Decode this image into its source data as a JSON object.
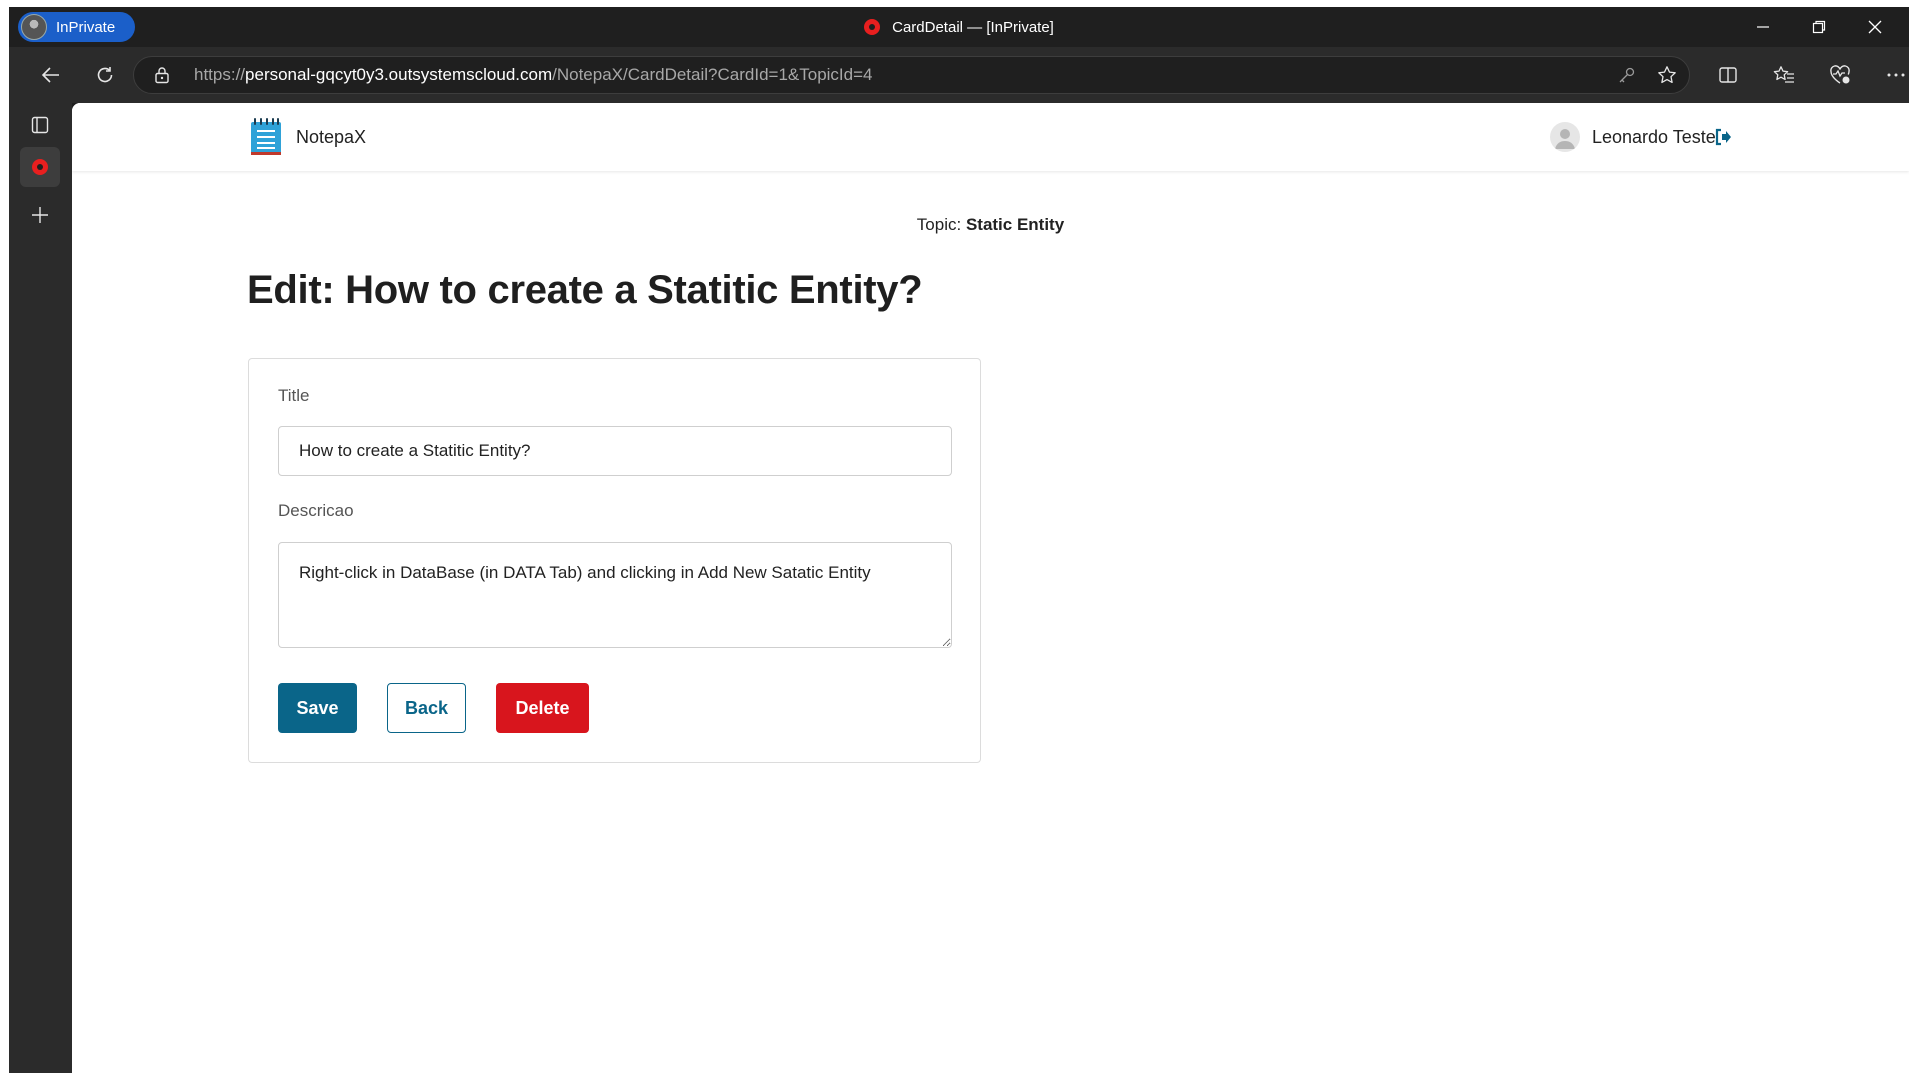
{
  "browser": {
    "inprivate_label": "InPrivate",
    "window_title": "CardDetail — [InPrivate]",
    "url_prefix": "https://",
    "url_host": "personal-gqcyt0y3.outsystemscloud.com",
    "url_path": "/NotepaX/CardDetail?CardId=1&TopicId=4"
  },
  "app": {
    "name": "NotepaX",
    "user_name": "Leonardo Teste"
  },
  "page": {
    "topic_label": "Topic: ",
    "topic_value": "Static Entity",
    "title": "Edit: How to create a Statitic Entity?"
  },
  "form": {
    "title_label": "Title",
    "title_value": "How to create a Statitic Entity?",
    "description_label": "Descricao",
    "description_value": "Right-click in DataBase (in DATA Tab) and clicking in Add New Satatic Entity",
    "save_label": "Save",
    "back_label": "Back",
    "delete_label": "Delete"
  },
  "colors": {
    "primary": "#0a6589",
    "danger": "#d8151d",
    "inprivate": "#1b5fc9"
  }
}
